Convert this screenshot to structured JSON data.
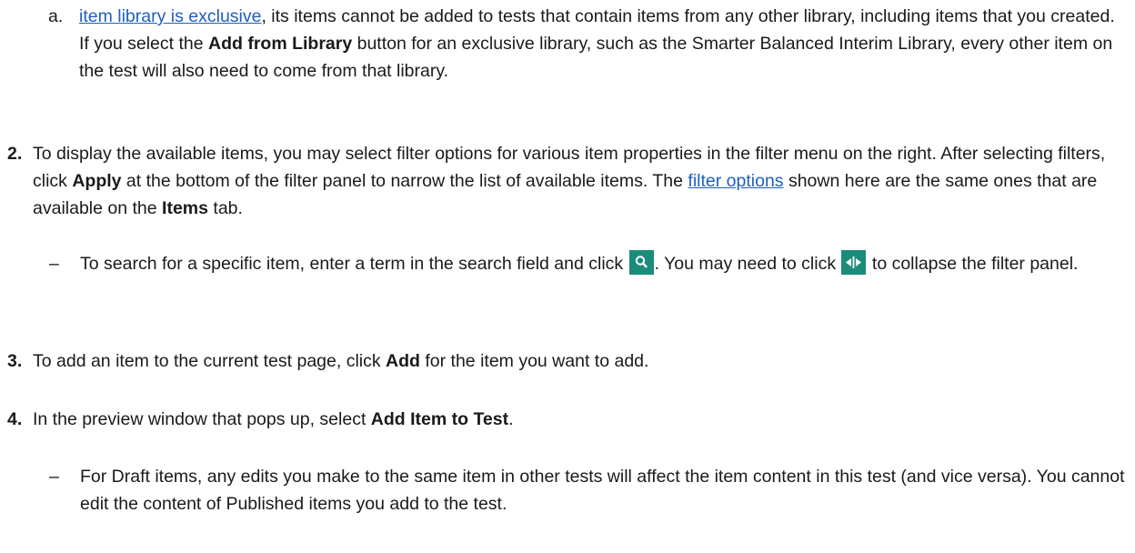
{
  "step_a": {
    "marker": "a.",
    "link1": "item library is exclusive",
    "t1": ", its items cannot be added to tests that contain items from any other library, including items that you created. If you select the ",
    "b1": "Add from Library",
    "t2": " button for an exclusive library, such as the Smarter Balanced Interim Library, every other item on the test will also need to come from that library."
  },
  "step_2": {
    "marker": "2.",
    "t1": "To display the available items, you may select filter options for various item properties in the filter menu on the right. After selecting filters, click ",
    "b1": "Apply",
    "t2": " at the bottom of the filter panel to narrow the list of available items. The ",
    "link1": "filter options",
    "t3": " shown here are the same ones that are available on the ",
    "b2": "Items",
    "t4": " tab."
  },
  "step_2_sub": {
    "marker": "–",
    "t1": "To search for a specific item, enter a term in the search field and click ",
    "icon1": "search-icon",
    "t2": ". You may need to click ",
    "icon2": "collapse-panel-icon",
    "t3": " to collapse the filter panel."
  },
  "step_3": {
    "marker": "3.",
    "t1": "To add an item to the current test page, click ",
    "b1": "Add",
    "t2": " for the item you want to add."
  },
  "step_4": {
    "marker": "4.",
    "t1": "In the preview window that pops up, select ",
    "b1": "Add Item to Test",
    "t2": "."
  },
  "step_4_sub": {
    "marker": "–",
    "t1": "For Draft items, any edits you make to the same item in other tests will affect the item content in this test (and vice versa). You cannot edit the content of Published items you add to the test."
  },
  "colors": {
    "link": "#1f5fbf",
    "icon_bg": "#1b8c7a"
  }
}
